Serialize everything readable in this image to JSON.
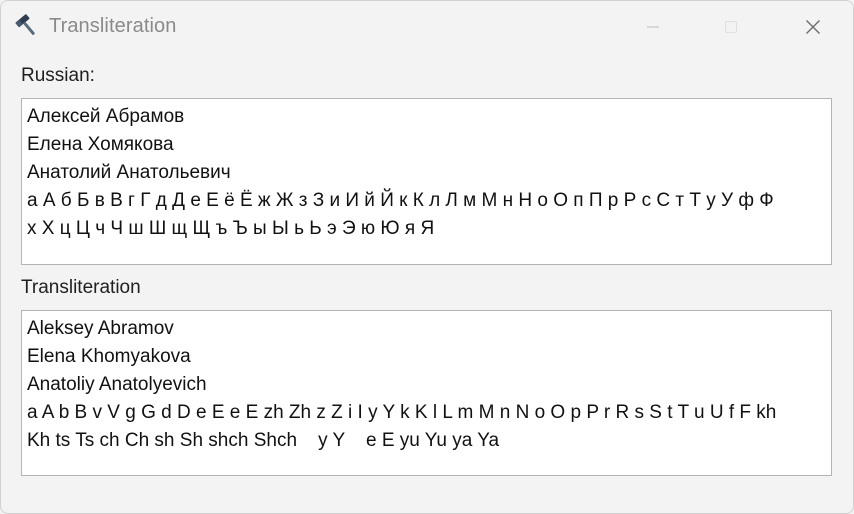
{
  "window": {
    "title": "Transliteration",
    "app_icon": "hammer-icon",
    "controls": {
      "minimize": "minimize-icon",
      "maximize": "maximize-icon",
      "close": "close-icon"
    }
  },
  "russian": {
    "label": "Russian:",
    "lines": [
      "Алексей Абрамов",
      "Елена Хомякова",
      "Анатолий Анатольевич",
      "а А б Б в В г Г д Д е Е ё Ё ж Ж з З и И й Й к К л Л м М н Н о О п П р Р с С т Т у У ф Ф",
      "х Х ц Ц ч Ч ш Ш щ Щ ъ Ъ ы Ы ь Ь э Э ю Ю я Я"
    ]
  },
  "transliteration": {
    "label": "Transliteration",
    "lines": [
      "Aleksey Abramov",
      "Elena Khomyakova",
      "Anatoliy Anatolyevich",
      "a A b B v V g G d D e E e E zh Zh z Z i I y Y k K l L m M n N o O p P r R s S t T u U f F kh",
      "Kh ts Ts ch Ch sh Sh shch Shch    y Y    e E yu Yu ya Ya"
    ]
  }
}
